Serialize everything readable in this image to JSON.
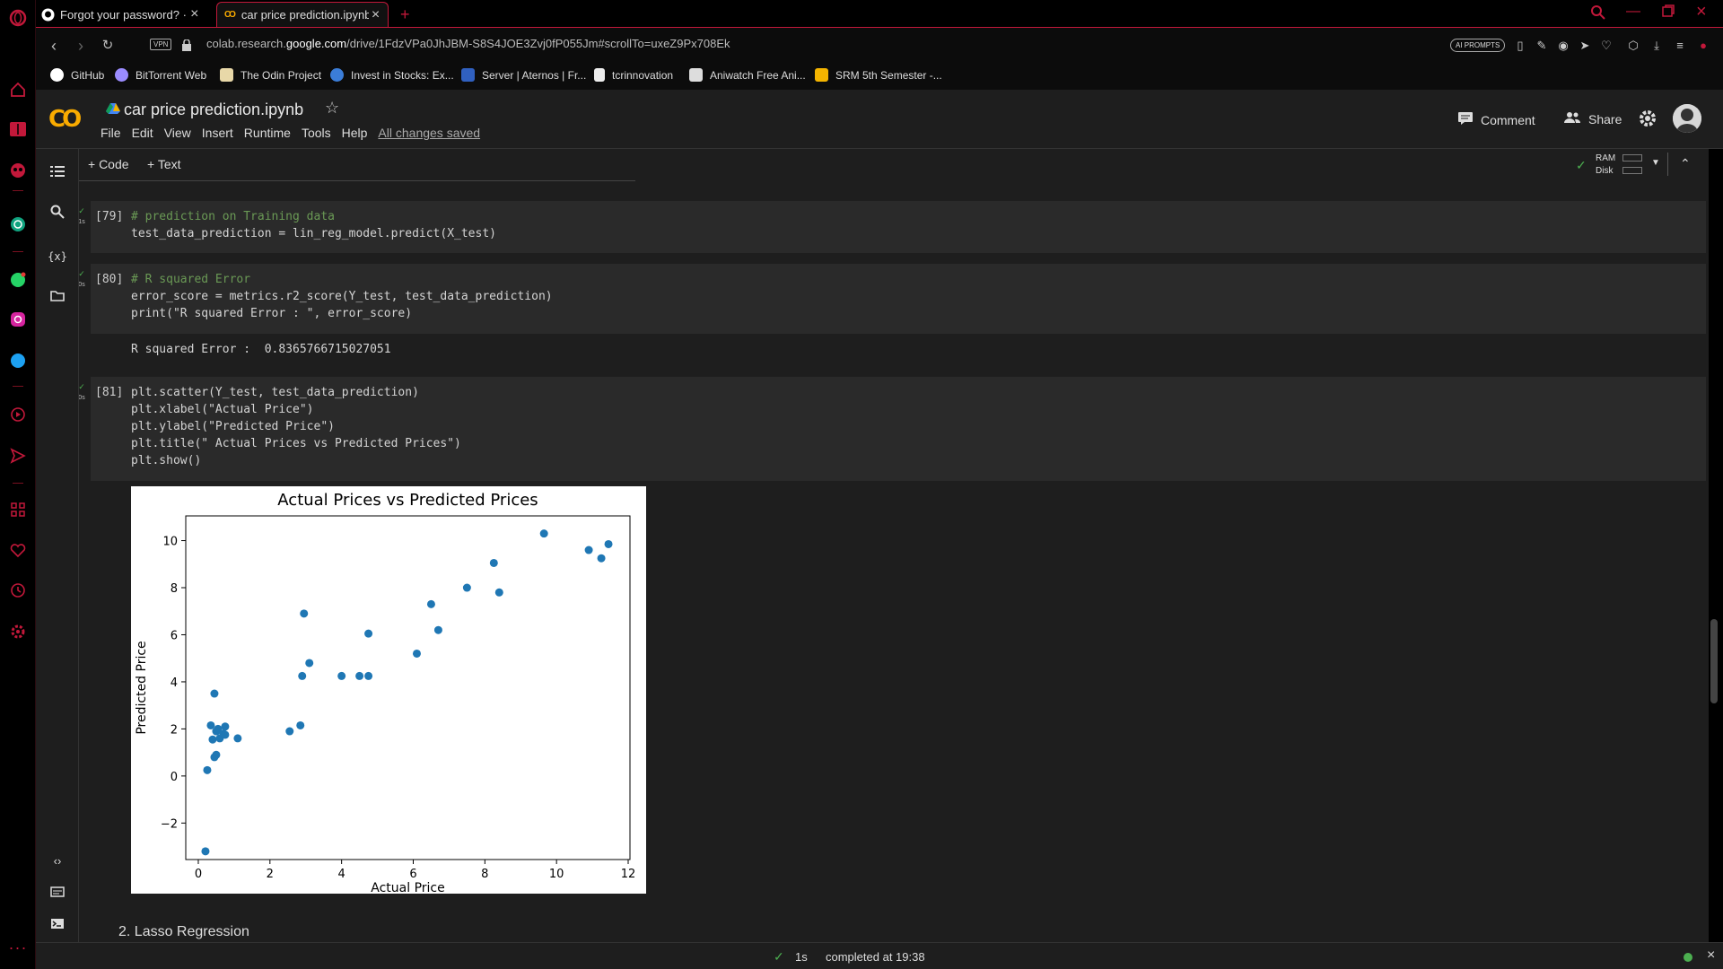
{
  "browser": {
    "tabs": [
      {
        "label": "Forgot your password? · Gi",
        "active": false
      },
      {
        "label": "car price prediction.ipynb ·",
        "active": true
      }
    ],
    "new_tab": "+",
    "vpn": "VPN",
    "url_prefix": "colab.research.",
    "url_host": "google.com",
    "url_path": "/drive/1FdzVPa0JhJBM-S8S4JOE3Zvj0fP055Jm#scrollTo=uxeZ9Px708Ek",
    "ai_prompts": "AI PROMPTS",
    "bookmarks": [
      {
        "label": "GitHub",
        "color": "#ffffff"
      },
      {
        "label": "BitTorrent Web",
        "color": "#9b8cff"
      },
      {
        "label": "The Odin Project",
        "color": "#e8d8a8"
      },
      {
        "label": "Invest in Stocks: Ex...",
        "color": "#3b7dd8"
      },
      {
        "label": "Server | Aternos | Fr...",
        "color": "#3060c0"
      },
      {
        "label": "tcrinnovation",
        "color": "#eeeeee"
      },
      {
        "label": "Aniwatch Free Ani...",
        "color": "#dddddd"
      },
      {
        "label": "SRM 5th Semester -...",
        "color": "#f4b400"
      }
    ]
  },
  "colab": {
    "logo": "CO",
    "title": "car price prediction.ipynb",
    "menu": [
      "File",
      "Edit",
      "View",
      "Insert",
      "Runtime",
      "Tools",
      "Help"
    ],
    "saved": "All changes saved",
    "comment": "Comment",
    "share": "Share",
    "add_code": "+ Code",
    "add_text": "+ Text",
    "ram": "RAM",
    "disk": "Disk"
  },
  "cells": [
    {
      "num": "[79]",
      "time": "1s",
      "lines": [
        "# prediction on Training data",
        "test_data_prediction = lin_reg_model.predict(X_test)"
      ]
    },
    {
      "num": "[80]",
      "time": "0s",
      "lines": [
        "# R squared Error",
        "error_score = metrics.r2_score(Y_test, test_data_prediction)",
        "print(\"R squared Error : \", error_score)"
      ],
      "output": "R squared Error :  0.8365766715027051"
    },
    {
      "num": "[81]",
      "time": "0s",
      "lines": [
        "plt.scatter(Y_test, test_data_prediction)",
        "plt.xlabel(\"Actual Price\")",
        "plt.ylabel(\"Predicted Price\")",
        "plt.title(\" Actual Prices vs Predicted Prices\")",
        "plt.show()"
      ]
    }
  ],
  "chart_data": {
    "type": "scatter",
    "title": "Actual Prices vs Predicted Prices",
    "xlabel": "Actual Price",
    "ylabel": "Predicted Price",
    "xlim": [
      -0.35,
      12.05
    ],
    "ylim": [
      -3.55,
      11.05
    ],
    "xticks": [
      0,
      2,
      4,
      6,
      8,
      10,
      12
    ],
    "yticks": [
      -2,
      0,
      2,
      4,
      6,
      8,
      10
    ],
    "color": "#1f77b4",
    "x": [
      0.2,
      0.25,
      0.35,
      0.4,
      0.45,
      0.45,
      0.5,
      0.5,
      0.55,
      0.6,
      0.7,
      0.75,
      0.75,
      1.1,
      2.55,
      2.85,
      2.9,
      2.95,
      3.1,
      4.0,
      4.5,
      4.75,
      4.75,
      6.1,
      6.5,
      6.7,
      7.5,
      8.25,
      8.4,
      9.65,
      10.9,
      11.25,
      11.45
    ],
    "y": [
      -3.2,
      0.25,
      2.15,
      1.55,
      3.5,
      0.8,
      0.9,
      1.9,
      2.0,
      1.6,
      1.8,
      1.75,
      2.1,
      1.6,
      1.9,
      2.15,
      4.25,
      6.9,
      4.8,
      4.25,
      4.25,
      4.25,
      6.05,
      5.2,
      7.3,
      6.2,
      8.0,
      9.05,
      7.8,
      10.3,
      9.6,
      9.25,
      9.85
    ]
  },
  "section": "2. Lasso Regression",
  "status": {
    "time": "1s",
    "text": "completed at 19:38"
  }
}
